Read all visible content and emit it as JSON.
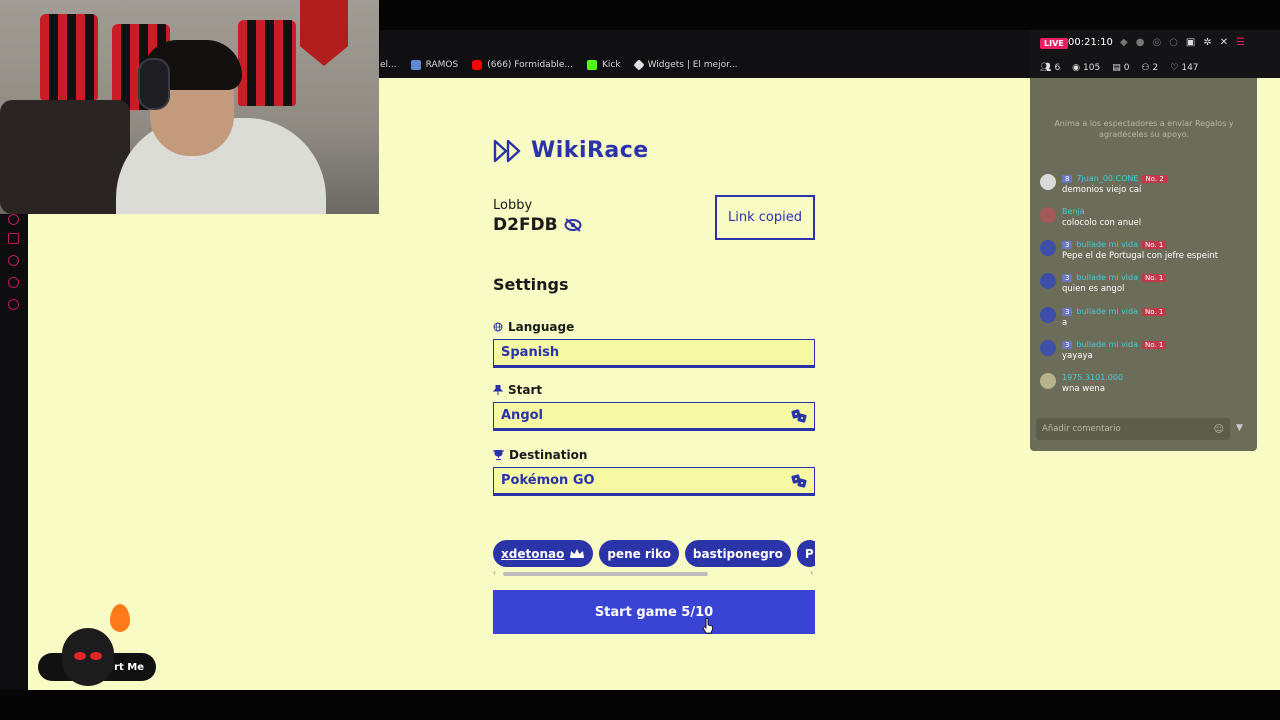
{
  "bookmarks": [
    {
      "label": "el...",
      "color": "#2d2d30"
    },
    {
      "label": "RAMOS",
      "color": "#5d88d6"
    },
    {
      "label": "(666) Formidable...",
      "color": "#ff0000"
    },
    {
      "label": "Kick",
      "color": "#53fc18"
    },
    {
      "label": "Widgets | El mejor...",
      "color": "#e0e0e0"
    }
  ],
  "app": {
    "title": "WikiRace",
    "lobby_label": "Lobby",
    "lobby_code": "D2FDB",
    "link_button": "Link copied",
    "settings_title": "Settings"
  },
  "fields": {
    "language": {
      "label": "Language",
      "value": "Spanish"
    },
    "start": {
      "label": "Start",
      "value": "Angol"
    },
    "destination": {
      "label": "Destination",
      "value": "Pokémon GO"
    }
  },
  "players": [
    "xdetonao",
    "pene riko",
    "bastiponegro",
    "P"
  ],
  "start_button": "Start game 5/10",
  "stream": {
    "live": "LIVE",
    "timer": "00:21:10",
    "stats": [
      "6",
      "105",
      "0",
      "2",
      "147"
    ],
    "note": "Anima a los espectadores a enviar Regalos y agradéceles su apoyo.",
    "comment_placeholder": "Añadir comentario",
    "messages": [
      {
        "badge": "8",
        "user": "7juan_00.CONE",
        "rank": "No. 2",
        "text": "demonios viejo caí"
      },
      {
        "badge": "",
        "user": "Benja",
        "rank": "",
        "text": "colocolo con anuel"
      },
      {
        "badge": "3",
        "user": "bullade mi vida",
        "rank": "No. 1",
        "text": "Pepe el de Portugal con jefre espeint"
      },
      {
        "badge": "3",
        "user": "bullade mi vida",
        "rank": "No. 1",
        "text": "quien es angol"
      },
      {
        "badge": "3",
        "user": "bullade mi vida",
        "rank": "No. 1",
        "text": "a"
      },
      {
        "badge": "3",
        "user": "bullade mi vida",
        "rank": "No. 1",
        "text": "yayaya"
      },
      {
        "badge": "",
        "user": "1975.3101.000",
        "rank": "",
        "text": "wna wena"
      }
    ]
  },
  "alert_widget": {
    "label": "rt Me"
  },
  "colors": {
    "accent": "#2a33a8",
    "page_bg": "#f9fbc4",
    "button": "#3a44d4",
    "live": "#e91e63"
  }
}
